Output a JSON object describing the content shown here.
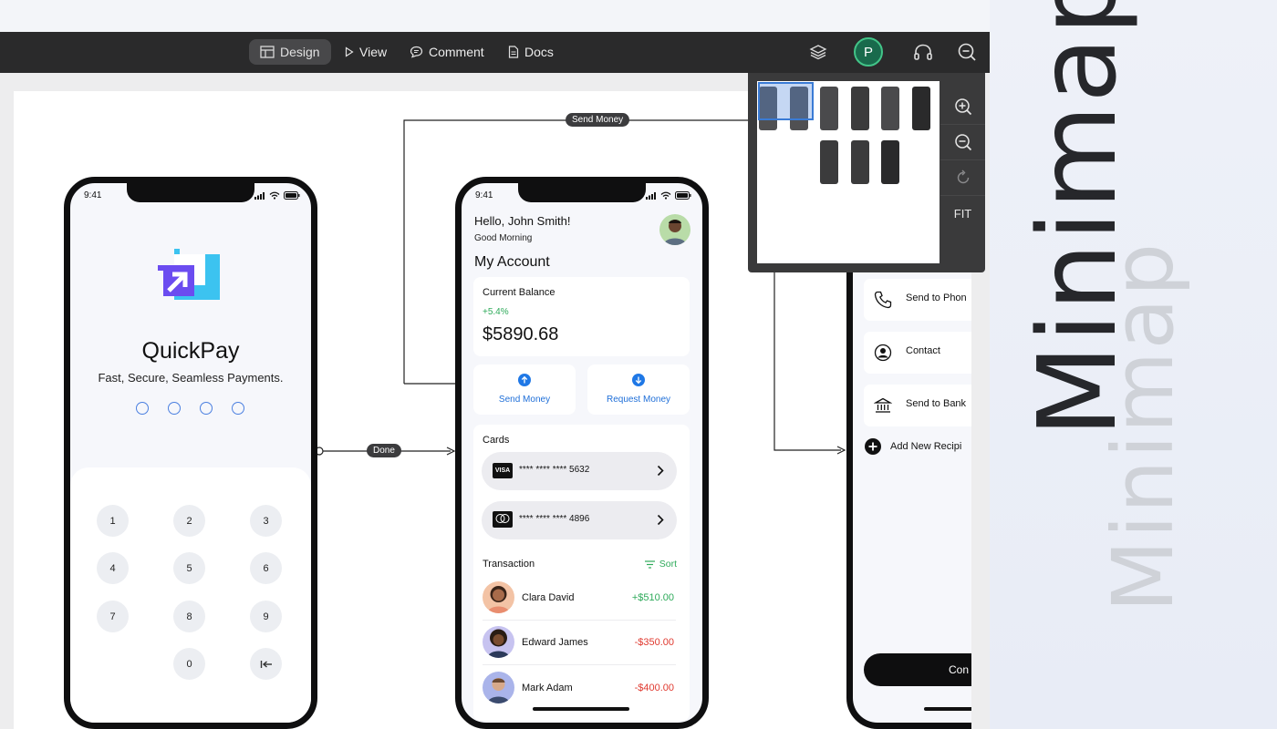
{
  "toolbar": {
    "tabs": [
      {
        "label": "Design",
        "icon": "layout-icon",
        "active": true
      },
      {
        "label": "View",
        "icon": "play-icon"
      },
      {
        "label": "Comment",
        "icon": "comment-icon"
      },
      {
        "label": "Docs",
        "icon": "doc-icon"
      }
    ],
    "avatar_initial": "P",
    "right_icons": [
      "layers-icon",
      "headphones-icon",
      "zoom-out-icon"
    ]
  },
  "flows": {
    "send_money_label": "Send Money",
    "done_label": "Done"
  },
  "login_screen": {
    "time": "9:41",
    "brand": "QuickPay",
    "tagline": "Fast, Secure, Seamless Payments.",
    "keys": [
      "1",
      "2",
      "3",
      "4",
      "5",
      "6",
      "7",
      "8",
      "9",
      "0"
    ]
  },
  "home_screen": {
    "time": "9:41",
    "greeting": "Hello, John Smith!",
    "subgreeting": "Good Morning",
    "section_title": "My Account",
    "balance_label": "Current Balance",
    "balance_change": "+5.4%",
    "balance_value": "$5890.68",
    "send_money": "Send Money",
    "request_money": "Request Money",
    "cards_title": "Cards",
    "cards": [
      {
        "brand": "VISA",
        "number": "**** **** **** 5632"
      },
      {
        "brand": "mastercard",
        "number": "**** **** **** 4896"
      }
    ],
    "transaction_title": "Transaction",
    "sort_label": "Sort",
    "transactions": [
      {
        "name": "Clara David",
        "amount": "+$510.00"
      },
      {
        "name": "Edward James",
        "amount": "-$350.00"
      },
      {
        "name": "Mark Adam",
        "amount": "-$400.00"
      }
    ]
  },
  "send_screen": {
    "options": [
      "Send to Phon",
      "Contact",
      "Send to Bank"
    ],
    "add_recipient": "Add New Recipi",
    "continue_label": "Con"
  },
  "minimap": {
    "controls": [
      "zoom-in-icon",
      "zoom-out-icon",
      "reset-icon"
    ],
    "fit_label": "FIT"
  },
  "heading": {
    "primary": "Minimap",
    "secondary": "Minimap"
  },
  "colors": {
    "positive": "#2eaa5a",
    "negative": "#e0392f",
    "accent_blue": "#1f78e6",
    "logo_purple": "#6b4cf0",
    "logo_cyan": "#3cc3f0"
  }
}
